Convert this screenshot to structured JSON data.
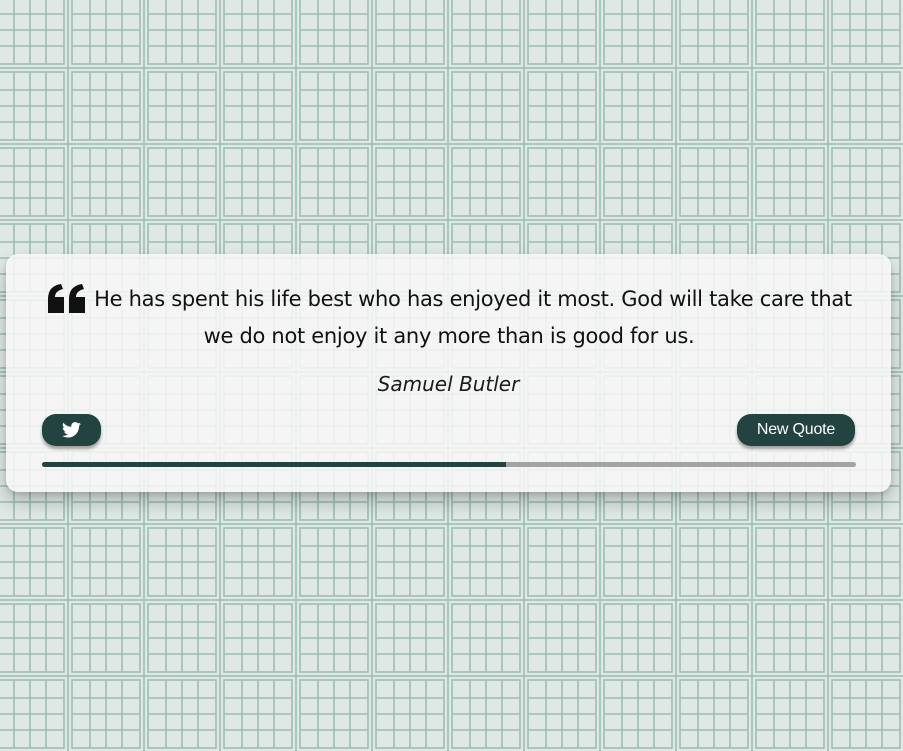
{
  "quote": {
    "text": "He has spent his life best who has enjoyed it most. God will take care that we do not enjoy it any more than is good for us.",
    "author": "Samuel Butler"
  },
  "buttons": {
    "tweet_icon": "twitter-icon",
    "new_quote_label": "New Quote"
  },
  "progress": {
    "fraction": 0.57
  },
  "colors": {
    "accent": "#224340",
    "background": "#dfe8e5",
    "pattern_line": "#9dbdb5",
    "progress_track": "#a3a3a3"
  }
}
